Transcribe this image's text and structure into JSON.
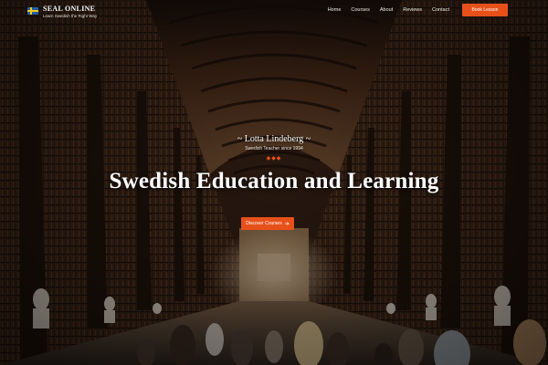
{
  "brand": {
    "name": "SEAL ONLINE",
    "tagline": "Learn Swedish the Right Way",
    "flag": "swedish-flag"
  },
  "nav": {
    "items": [
      "Home",
      "Courses",
      "About",
      "Reviews",
      "Contact"
    ],
    "book_label": "Book Lesson"
  },
  "hero": {
    "teacher": "~ Lotta Lindeberg ~",
    "since": "Swedish Teacher since 1994",
    "ornament": "◆◆◆",
    "title": "Swedish Education and Learning",
    "cta_label": "Discover Courses",
    "cta_icon": "arrow-right-icon",
    "background": "library-hall-photo"
  },
  "colors": {
    "accent": "#e8501a"
  }
}
